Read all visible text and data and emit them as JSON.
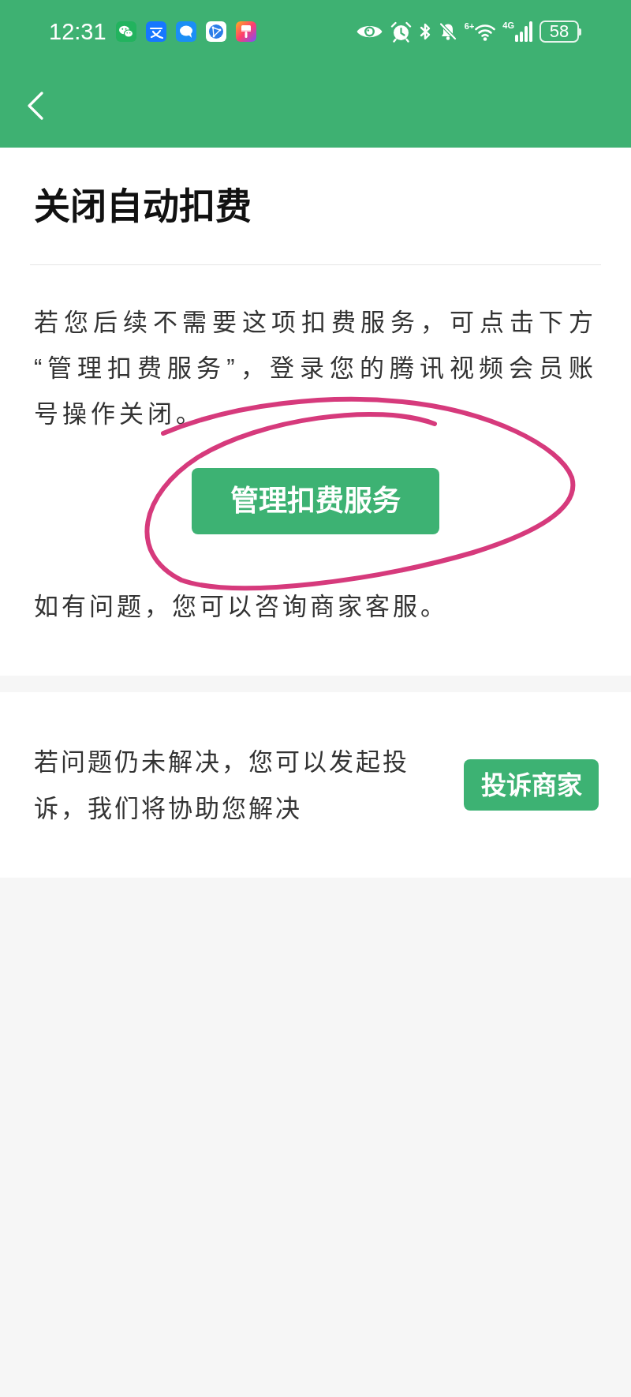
{
  "status_bar": {
    "time": "12:31",
    "wifi_label": "6+",
    "network_type": "4G",
    "battery": "58"
  },
  "main_card": {
    "title": "关闭自动扣费",
    "description": "若您后续不需要这项扣费服务，可点击下方“管理扣费服务”，登录您的腾讯视频会员账号操作关闭。",
    "button": "管理扣费服务",
    "note": "如有问题，您可以咨询商家客服。"
  },
  "complaint_card": {
    "text": "若问题仍未解决，您可以发起投诉，我们将协助您解决",
    "button": "投诉商家"
  }
}
